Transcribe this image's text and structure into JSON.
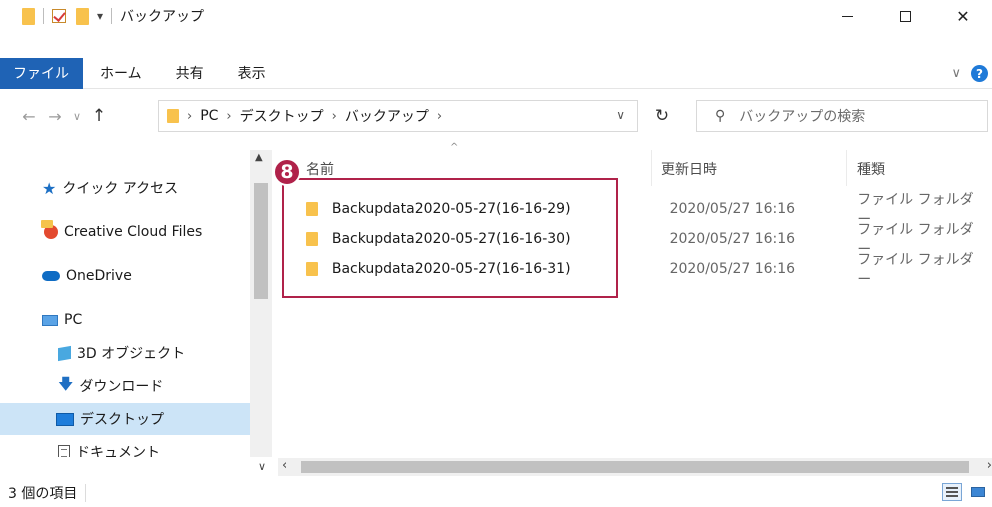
{
  "window": {
    "title": "バックアップ",
    "minimize_symbol": "—",
    "close_symbol": "✕"
  },
  "ribbon": {
    "tabs": [
      "ファイル",
      "ホーム",
      "共有",
      "表示"
    ],
    "help_label": "?",
    "collapse_symbol": "∨"
  },
  "address": {
    "crumbs": [
      "PC",
      "デスクトップ",
      "バックアップ"
    ],
    "search_placeholder": "バックアップの検索"
  },
  "navpane": {
    "items": [
      {
        "label": "クイック アクセス",
        "icon": "star-icon"
      },
      {
        "label": "Creative Cloud Files",
        "icon": "creative-cloud-icon"
      },
      {
        "label": "OneDrive",
        "icon": "cloud-icon"
      },
      {
        "label": "PC",
        "icon": "pc-icon"
      },
      {
        "label": "3D オブジェクト",
        "icon": "3d-object-icon"
      },
      {
        "label": "ダウンロード",
        "icon": "download-icon"
      },
      {
        "label": "デスクトップ",
        "icon": "desktop-icon",
        "selected": true
      },
      {
        "label": "ドキュメント",
        "icon": "document-icon"
      }
    ]
  },
  "columns": {
    "name": "名前",
    "date": "更新日時",
    "type": "種類"
  },
  "files": [
    {
      "name": "Backupdata2020-05-27(16-16-29)",
      "date": "2020/05/27 16:16",
      "type": "ファイル フォルダー"
    },
    {
      "name": "Backupdata2020-05-27(16-16-30)",
      "date": "2020/05/27 16:16",
      "type": "ファイル フォルダー"
    },
    {
      "name": "Backupdata2020-05-27(16-16-31)",
      "date": "2020/05/27 16:16",
      "type": "ファイル フォルダー"
    }
  ],
  "annotation": {
    "step_number": "8",
    "highlight_color": "#b0224a"
  },
  "status": {
    "item_count": "3 個の項目"
  },
  "colors": {
    "file_tab": "#1f63b5",
    "selection": "#cce4f7",
    "folder": "#f8c24d"
  }
}
